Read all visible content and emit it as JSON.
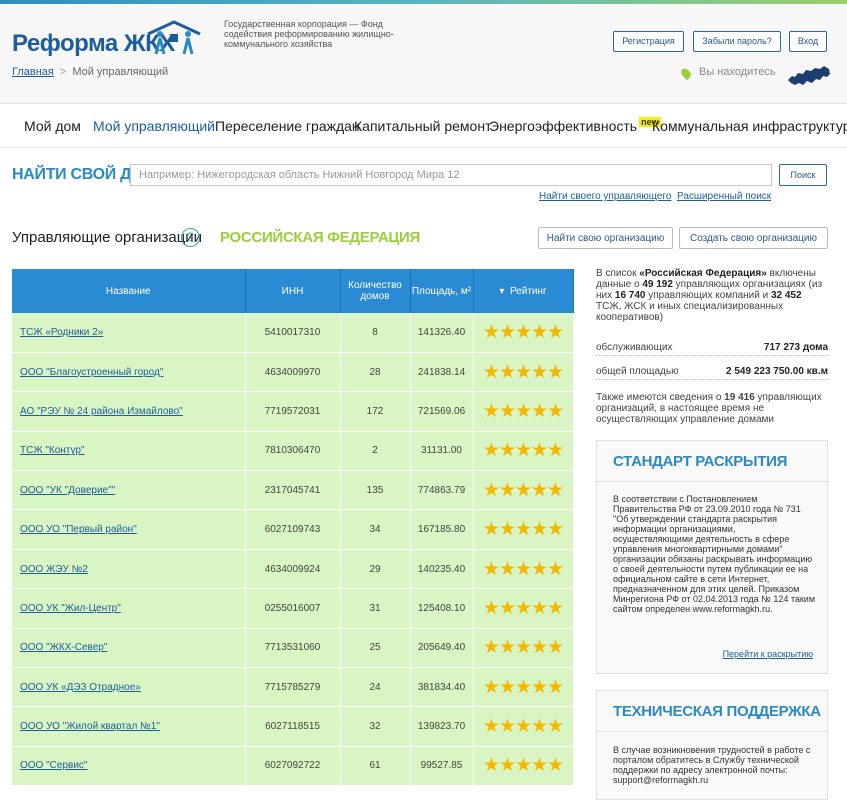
{
  "header": {
    "logo_text": "Реформа ЖКХ",
    "org_text": "Государственная корпорация — Фонд содействия реформированию жилищно-коммунального хозяйства",
    "buttons": {
      "register": "Регистрация",
      "forgot": "Забыли пароль?",
      "login": "Вход"
    },
    "location_label": "Вы находитесь"
  },
  "breadcrumb": {
    "home": "Главная",
    "current": "Мой управляющий",
    "separator": ">"
  },
  "nav": {
    "items": [
      "Мой дом",
      "Мой управляющий",
      "Переселение граждан",
      "Капитальный ремонт",
      "Энергоэффективность",
      "Коммунальная инфраструктура"
    ],
    "new_badge": "new"
  },
  "search": {
    "label": "НАЙТИ СВОЙ ДОМ",
    "placeholder": "Например: Нижегородская область Нижний Новгород Мира 12",
    "button": "Поиск",
    "link_manager": "Найти своего управляющего",
    "link_advanced": "Расширенный поиск"
  },
  "section": {
    "title": "Управляющие организации",
    "help": "?",
    "region": "РОССИЙСКАЯ ФЕДЕРАЦИЯ",
    "find_org": "Найти свою организацию",
    "create_org": "Создать свою организацию"
  },
  "table": {
    "headers": {
      "name": "Название",
      "inn": "ИНН",
      "houses": "Количество домов",
      "area": "Площадь, м²",
      "rating": "Рейтинг",
      "sort_mark": "▾"
    },
    "rows": [
      {
        "name": "ТСЖ «Родники 2»",
        "inn": "5410017310",
        "houses": "8",
        "area": "141326.40",
        "rating": 5
      },
      {
        "name": "ООО \"Благоустроенный город\"",
        "inn": "4634009970",
        "houses": "28",
        "area": "241838.14",
        "rating": 5
      },
      {
        "name": "АО \"РЭУ № 24 района Измайлово\"",
        "inn": "7719572031",
        "houses": "172",
        "area": "721569.06",
        "rating": 5
      },
      {
        "name": "ТСЖ \"Контур\"",
        "inn": "7810306470",
        "houses": "2",
        "area": "31131.00",
        "rating": 5
      },
      {
        "name": "ООО \"УК \"Доверие\"\"",
        "inn": "2317045741",
        "houses": "135",
        "area": "774863.79",
        "rating": 5
      },
      {
        "name": "ООО УО \"Первый район\"",
        "inn": "6027109743",
        "houses": "34",
        "area": "167185.80",
        "rating": 5
      },
      {
        "name": "ООО ЖЭУ №2",
        "inn": "4634009924",
        "houses": "29",
        "area": "140235.40",
        "rating": 5
      },
      {
        "name": "ООО УК \"Жил-Центр\"",
        "inn": "0255016007",
        "houses": "31",
        "area": "125408.10",
        "rating": 5
      },
      {
        "name": "ООО \"ЖКХ-Север\"",
        "inn": "7713531060",
        "houses": "25",
        "area": "205649.40",
        "rating": 5
      },
      {
        "name": "ООО УК «ДЭЗ Отрадное»",
        "inn": "7715785279",
        "houses": "24",
        "area": "381834.40",
        "rating": 5
      },
      {
        "name": "ООО УО \"Жилой квартал №1\"",
        "inn": "6027118515",
        "houses": "32",
        "area": "139823.70",
        "rating": 5
      },
      {
        "name": "ООО \"Сервис\"",
        "inn": "6027092722",
        "houses": "61",
        "area": "99527.85",
        "rating": 5
      }
    ]
  },
  "sidebar": {
    "info_prefix": "В список ",
    "info_region": "«Российская Федерация»",
    "info_mid1": " включены данные о ",
    "info_total": "49 192",
    "info_mid2": " управляющих организациях (из них ",
    "info_uk": "16 740",
    "info_mid3": " управляющих компаний и ",
    "info_tsj": "32 452",
    "info_suffix": " ТСЖ, ЖСК и иных специализированных кооперативов)",
    "served_label": "обслуживающих",
    "served_value": "717 273 дома",
    "area_label": "общей площадью",
    "area_value": "2 549 223 750.00 кв.м",
    "note_prefix": "Также имеются сведения о ",
    "note_count": "19 416",
    "note_suffix": " управляющих организаций, в настоящее время не осуществляющих управление домами",
    "standard": {
      "title": "СТАНДАРТ РАСКРЫТИЯ",
      "text": "В соответствии с Постановлением Правительства РФ от 23.09.2010 года № 731 \"Об утверждении стандарта раскрытия информации организациями, осуществляющими деятельность в сфере управления многоквартирными домами\" организации обязаны раскрывать информацию о своей деятельности путем публикации ее на официальном сайте в сети Интернет, предназначенном для этих целей. Приказом Минрегиона РФ от 02.04.2013 года № 124 таким сайтом определен www.reformagkh.ru.",
      "link": "Перейти к раскрытию"
    },
    "support": {
      "title": "ТЕХНИЧЕСКАЯ ПОДДЕРЖКА",
      "text": "В случае возникновения трудностей в работе с порталом обратитесь в Службу технической поддержки по адресу электронной почты: support@reformagkh.ru"
    }
  },
  "colors": {
    "accent": "#2a8ad4",
    "row_bg": "#d9f5c4",
    "region_green": "#9bcf3a",
    "star": "#f5b800"
  }
}
